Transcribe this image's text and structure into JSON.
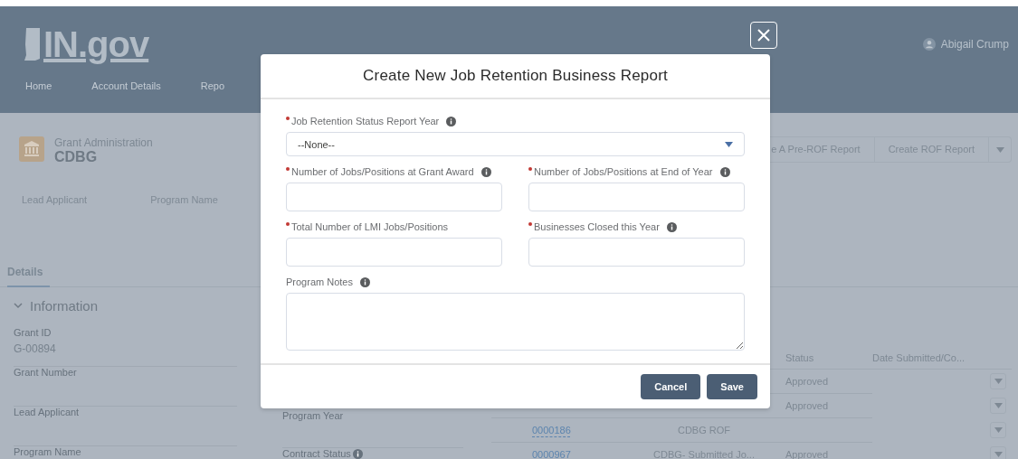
{
  "header": {
    "logo": "IN.gov",
    "user": "Abigail Crump",
    "nav": [
      {
        "label": "Home"
      },
      {
        "label": "Account Details"
      },
      {
        "label": "Repo"
      }
    ]
  },
  "record": {
    "type": "Grant Administration",
    "name": "CDBG",
    "highlights": [
      "Lead Applicant",
      "Program Name"
    ],
    "actions": [
      "e A Pre-ROF Report",
      "Create ROF Report"
    ]
  },
  "tabs": [
    {
      "label": "Details",
      "selected": true
    }
  ],
  "section": {
    "title": "Information",
    "expanded": true,
    "fields": [
      {
        "label": "Grant ID",
        "value": "G-00894",
        "info": false
      },
      {
        "label": "Grant Number",
        "info": false
      },
      {
        "label": "Lead Applicant",
        "info": false
      },
      {
        "label": "Program Name",
        "info": false
      }
    ],
    "fields_column_2": [
      {
        "label": "Program Year",
        "info": false
      },
      {
        "label": "Contract Status",
        "info": true
      }
    ]
  },
  "related_table": {
    "columns": [
      {
        "label": "Status"
      },
      {
        "label": "Date Submitted/Co..."
      }
    ],
    "rows": [
      {
        "status": "Approved"
      },
      {
        "status": "Approved"
      },
      {
        "number": "0000186",
        "type": "CDBG ROF"
      },
      {
        "number": "0000967",
        "type": "CDBG- Submitted Jo...",
        "status": "Approved"
      }
    ]
  },
  "modal": {
    "title": "Create New Job Retention Business Report",
    "fields": [
      {
        "kind": "select",
        "label": "Job Retention Status Report Year",
        "required": true,
        "info": true,
        "value": "--None--"
      },
      {
        "kind": "text",
        "label": "Number of Jobs/Positions at Grant Award",
        "required": true,
        "info": true
      },
      {
        "kind": "text",
        "label": "Number of Jobs/Positions at End of Year",
        "required": true,
        "info": true
      },
      {
        "kind": "text",
        "label": "Total Number of LMI Jobs/Positions",
        "required": true,
        "info": false
      },
      {
        "kind": "text",
        "label": "Businesses Closed this Year",
        "required": true,
        "info": true
      },
      {
        "kind": "textarea",
        "label": "Program Notes",
        "required": false,
        "info": true
      }
    ],
    "buttons": [
      {
        "label": "Cancel"
      },
      {
        "label": "Save"
      }
    ]
  }
}
